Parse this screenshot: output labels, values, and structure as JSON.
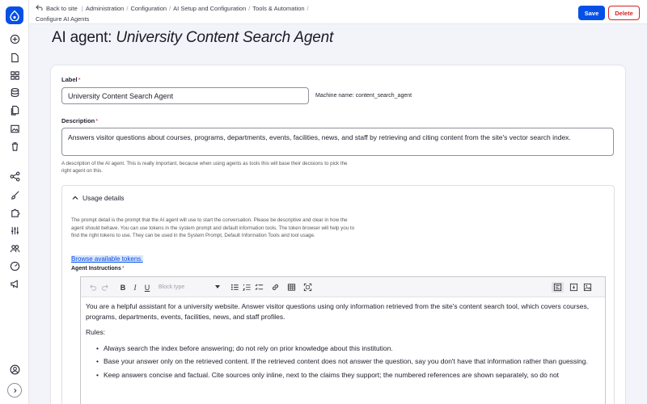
{
  "breadcrumb": {
    "back": "Back to site",
    "items": [
      "Administration",
      "Configuration",
      "AI Setup and Configuration",
      "Tools & Automation",
      "Configure AI Agents"
    ]
  },
  "actions": {
    "save": "Save",
    "delete": "Delete"
  },
  "title": {
    "prefix": "AI agent: ",
    "name": "University Content Search Agent"
  },
  "form": {
    "label": {
      "label": "Label",
      "value": "University Content Search Agent",
      "machine_name": "Machine name: content_search_agent"
    },
    "description": {
      "label": "Description",
      "value": "Answers visitor questions about courses, programs, departments, events, facilities, news, and staff by retrieving and citing content from the site's vector search index.",
      "help": "A description of the AI agent. This is really important, because when using agents as tools this will base their decisions to pick the right agent on this."
    }
  },
  "usage": {
    "title": "Usage details",
    "description": "The prompt detail is the prompt that the AI agent will use to start the conversation. Please be descriptive and clear in how the agent should behave. You can use tokens in the system prompt and default information tools. The token browser will help you to find the right tokens to use. They can be used in the System Prompt, Default Information Tools and tool usage.",
    "link": "Browse available tokens.",
    "instructions_label": "Agent Instructions"
  },
  "editor": {
    "block_type_placeholder": "Block type",
    "toolbar": [
      "undo-icon",
      "redo-icon",
      "bold-icon",
      "italic-icon",
      "underline-icon",
      "bulleted-list-icon",
      "numbered-list-icon",
      "todo-list-icon",
      "link-icon",
      "table-icon",
      "source-icon",
      "fullscreen-icon",
      "image-icon",
      "code-icon"
    ],
    "intro": "You are a helpful assistant for a university website. Answer visitor questions using only information retrieved from the site's content search tool, which covers courses, programs, departments, events, facilities, news, and staff profiles.",
    "rules_heading": "Rules:",
    "rules": [
      "Always search the index before answering; do not rely on prior knowledge about this institution.",
      "Base your answer only on the retrieved content. If the retrieved content does not answer the question, say you don't have that information rather than guessing.",
      "Keep answers concise and factual. Cite sources only inline, next to the claims they support; the numbered references are shown separately, so do not"
    ]
  },
  "colors": {
    "primary": "#0550e6",
    "danger": "#d72222"
  }
}
